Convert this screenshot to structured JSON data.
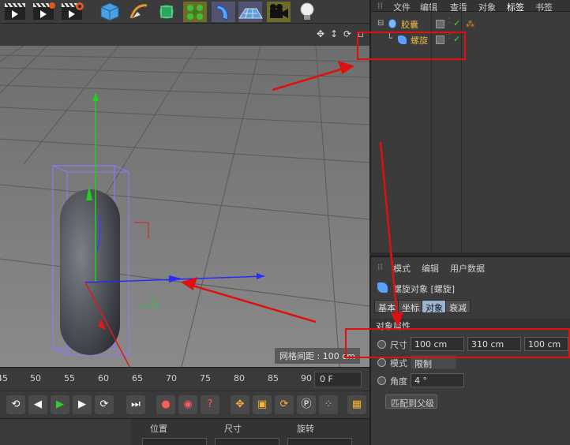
{
  "object_manager": {
    "menu": [
      "文件",
      "编辑",
      "查看",
      "对象",
      "标签",
      "书签"
    ],
    "objects": [
      {
        "name": "胶囊",
        "icon": "capsule-icon"
      },
      {
        "name": "螺旋",
        "icon": "twist-deformer-icon"
      }
    ]
  },
  "attribute_manager": {
    "menu": [
      "模式",
      "编辑",
      "用户数据"
    ],
    "object_title": "螺旋对象 [螺旋]",
    "tabs": [
      "基本",
      "坐标",
      "对象",
      "衰减"
    ],
    "active_tab": "对象",
    "section_title": "对象属性",
    "size_label": "尺寸",
    "size_values": [
      "100 cm",
      "310 cm",
      "100 cm"
    ],
    "mode_label": "模式",
    "mode_value": "限制",
    "angle_label": "角度",
    "angle_value": "4 °",
    "fit_button": "匹配到父级"
  },
  "viewport": {
    "grid_readout": "网格间距 : 100 cm",
    "nav_icons": [
      "move-view-icon",
      "dolly-view-icon",
      "rotate-view-icon",
      "maximize-view-icon"
    ]
  },
  "timeline": {
    "ticks": [
      "45",
      "50",
      "55",
      "60",
      "65",
      "70",
      "75",
      "80",
      "85",
      "90"
    ],
    "current_frame": "0 F"
  },
  "coordinates": {
    "headers": [
      "位置",
      "尺寸",
      "旋转"
    ]
  },
  "toolbar": {
    "icons": [
      "render-view-icon",
      "render-picture-viewer-icon",
      "edit-render-settings-icon",
      "cube-icon",
      "pen-icon",
      "subdivision-icon",
      "array-icon",
      "deformer-icon",
      "floor-icon",
      "camera-icon",
      "light-icon"
    ]
  },
  "colors": {
    "annotation": "#e01010",
    "active_tab": "#9db4d1",
    "object_name": "#e8b84a"
  }
}
